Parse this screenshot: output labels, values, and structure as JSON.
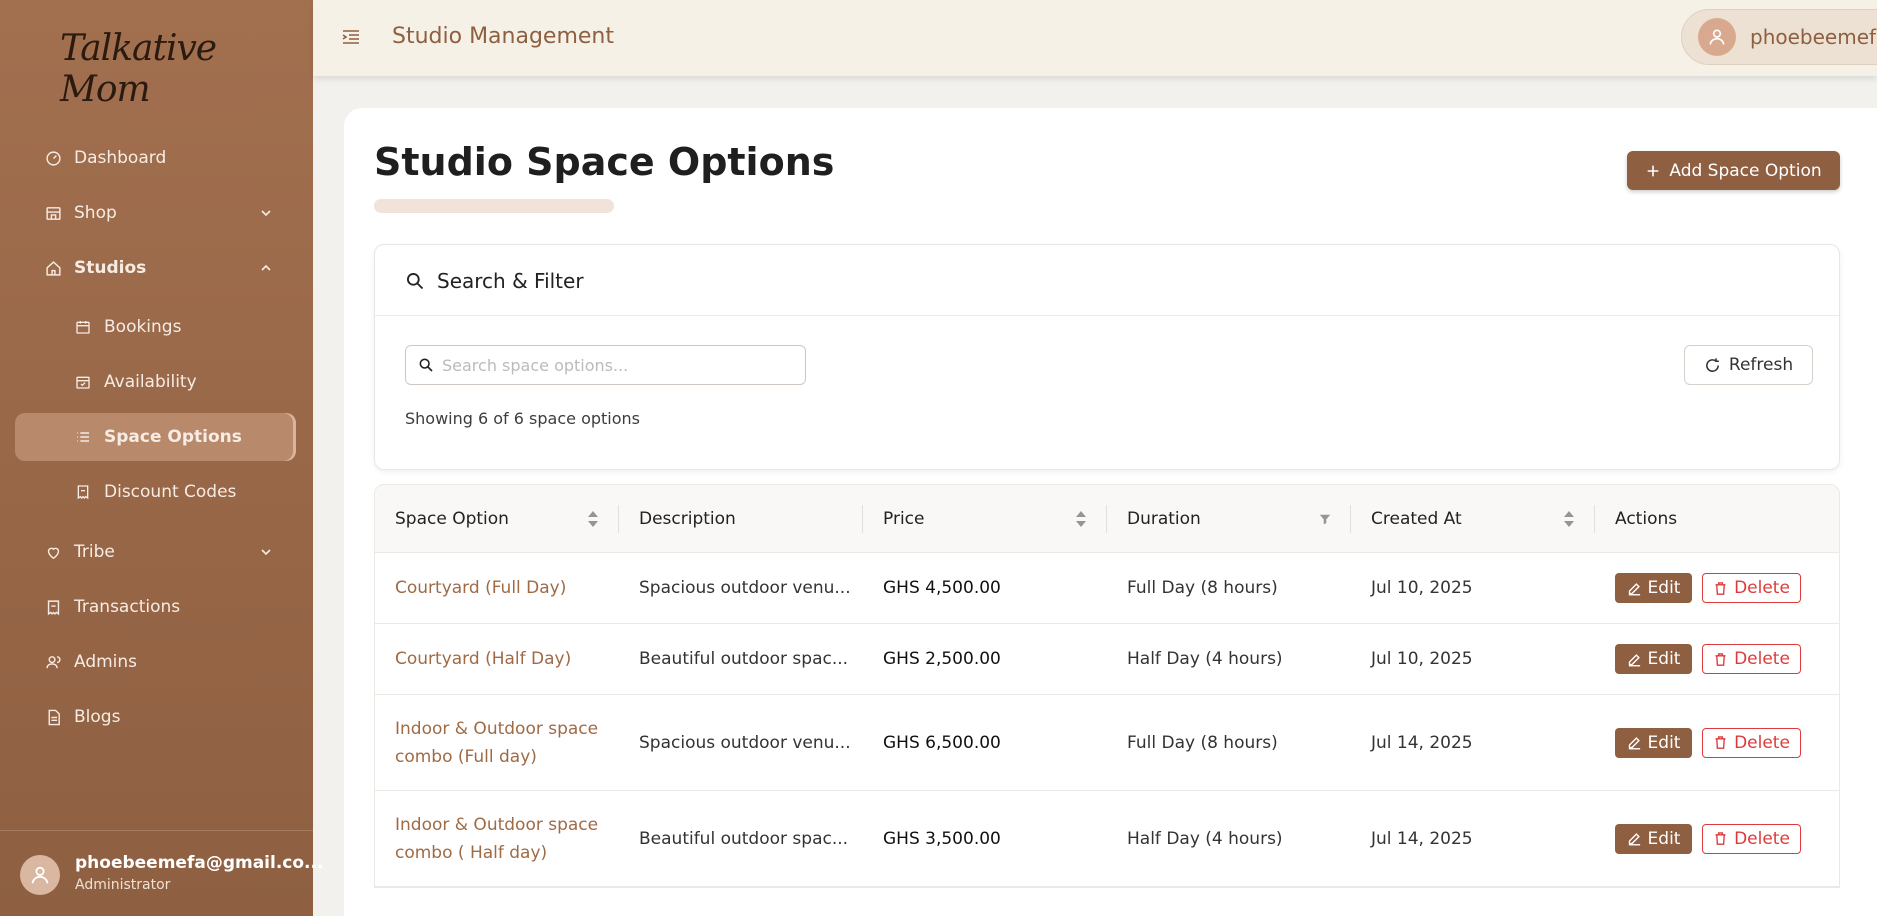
{
  "sidebar": {
    "logo": "Talkative Mom",
    "items": [
      {
        "label": "Dashboard"
      },
      {
        "label": "Shop"
      },
      {
        "label": "Studios"
      },
      {
        "label": "Bookings"
      },
      {
        "label": "Availability"
      },
      {
        "label": "Space Options"
      },
      {
        "label": "Discount Codes"
      },
      {
        "label": "Tribe"
      },
      {
        "label": "Transactions"
      },
      {
        "label": "Admins"
      },
      {
        "label": "Blogs"
      }
    ],
    "user": {
      "email": "phoebeemefa@gmail.co...",
      "role": "Administrator"
    }
  },
  "header": {
    "title": "Studio Management",
    "profile_name": "phoebeemefa"
  },
  "page": {
    "title": "Studio Space Options",
    "add_button": "Add Space Option"
  },
  "filter": {
    "title": "Search & Filter",
    "search_placeholder": "Search space options...",
    "refresh_label": "Refresh",
    "showing": "Showing 6 of 6 space options"
  },
  "table": {
    "columns": [
      "Space Option",
      "Description",
      "Price",
      "Duration",
      "Created At",
      "Actions"
    ],
    "edit_label": "Edit",
    "delete_label": "Delete",
    "rows": [
      {
        "name": "Courtyard (Full Day)",
        "description": "Spacious outdoor venu...",
        "price": "GHS 4,500.00",
        "duration": "Full Day (8 hours)",
        "created": "Jul 10, 2025"
      },
      {
        "name": "Courtyard (Half Day)",
        "description": "Beautiful outdoor spac...",
        "price": "GHS 2,500.00",
        "duration": "Half Day (4 hours)",
        "created": "Jul 10, 2025"
      },
      {
        "name": "Indoor & Outdoor space combo (Full day)",
        "description": "Spacious outdoor venu...",
        "price": "GHS 6,500.00",
        "duration": "Full Day (8 hours)",
        "created": "Jul 14, 2025"
      },
      {
        "name": "Indoor & Outdoor space combo ( Half day)",
        "description": "Beautiful outdoor spac...",
        "price": "GHS 3,500.00",
        "duration": "Half Day (4 hours)",
        "created": "Jul 14, 2025"
      }
    ]
  },
  "colors": {
    "brand": "#8e5f41",
    "accent_text": "#a06a45",
    "danger": "#dc3b3b",
    "sidebar": "#9b6a4a"
  }
}
